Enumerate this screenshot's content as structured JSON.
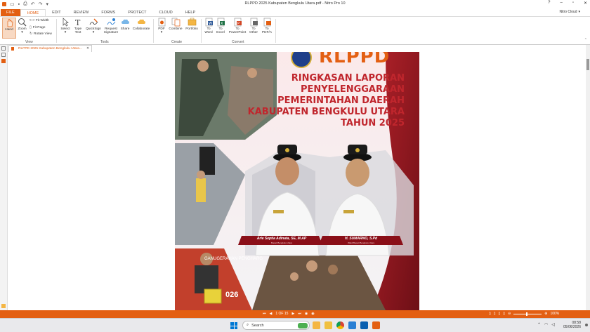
{
  "window": {
    "title": "RLPPD 2025 Kabupaten Bengkulu Utara.pdf - Nitro Pro 10"
  },
  "ribbon_tabs": [
    "FILE",
    "HOME",
    "EDIT",
    "REVIEW",
    "FORMS",
    "PROTECT",
    "CLOUD",
    "HELP"
  ],
  "nitro_cloud_label": "Nitro Cloud",
  "view_group": {
    "label": "View",
    "hand": "Hand",
    "zoom": "Zoom",
    "fit_width": "Fit Width",
    "fit_page": "Fit Page",
    "rotate_view": "Rotate View"
  },
  "tools_group": {
    "label": "Tools",
    "select": "Select",
    "type_text": "Type Text",
    "quicksign": "QuickSign",
    "request_signature": "Request Signature",
    "share": "Share",
    "collaborate": "Collaborate"
  },
  "create_group": {
    "label": "Create",
    "pdf": "PDF",
    "combine": "Combine",
    "portfolio": "Portfolio"
  },
  "convert_group": {
    "label": "Convert",
    "word": "To Word",
    "excel": "To Excel",
    "powerpoint": "To PowerPoint",
    "other": "To Other",
    "pdfa": "To PDF/A"
  },
  "document_tab": "RLPPD 2025 Kabupaten Bengkulu Utara...",
  "page_content": {
    "logo_text": "RLPPD",
    "heading_lines": [
      "RINGKASAN LAPORAN",
      "PENYELENGGARAAN",
      "PEMERINTAHAN DAERAH",
      "KABUPATEN BENGKULU UTARA",
      "TAHUN 2025"
    ],
    "person_left_name": "Arie Septia Adinata, SE, M.AP",
    "person_left_role": "Bupati Bengkulu Utara",
    "person_right_name": "H. SUMARNO, S.Pd",
    "person_right_role": "Wakil Bupati Bengkulu Utara",
    "banner_text_1": "GANUGERAHAN PENGHARG",
    "banner_text_2": "026"
  },
  "page_nav": {
    "indicator": "1 OF 15"
  },
  "zoom_level": "100%",
  "taskbar": {
    "search_placeholder": "Search",
    "time": "08:58",
    "date": "05/06/2026"
  },
  "colors": {
    "accent": "#e35f12",
    "cover_red": "#9a1b23",
    "heading_red": "#c0262d"
  }
}
